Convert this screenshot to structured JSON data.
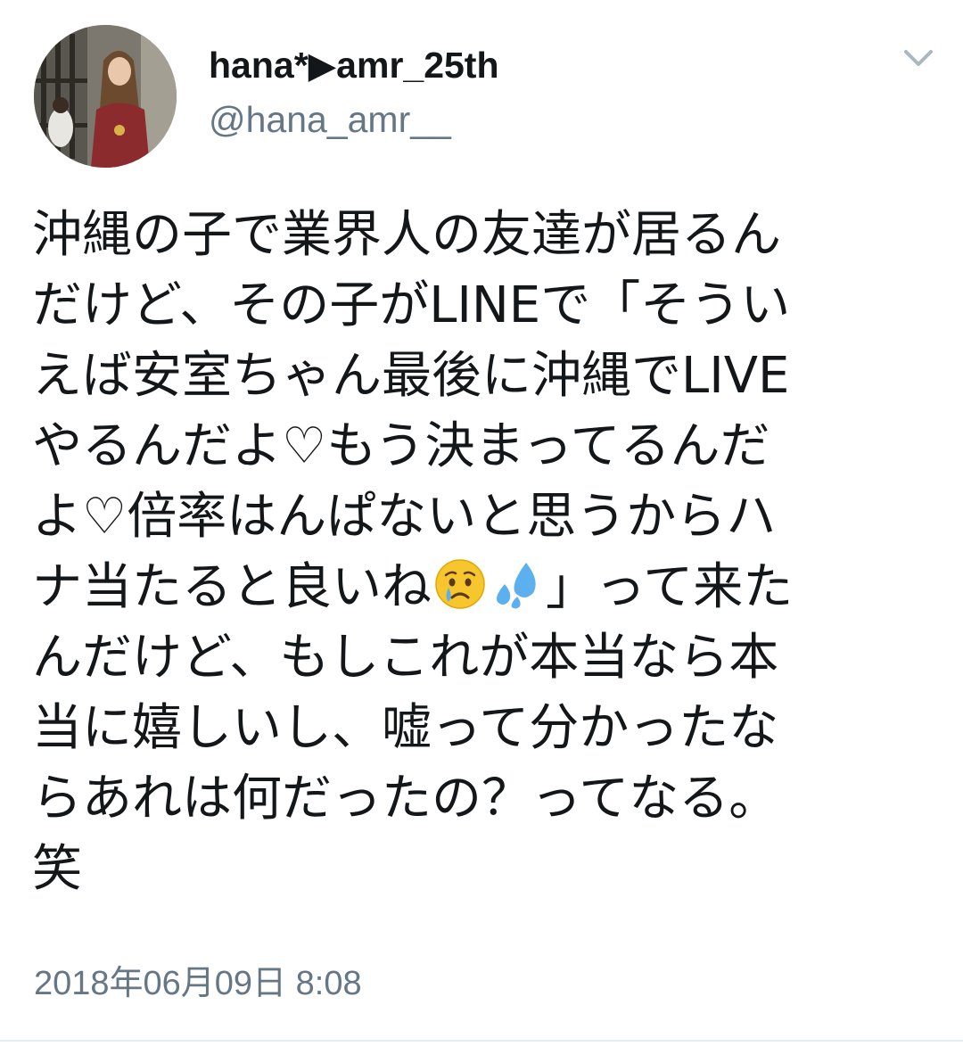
{
  "colors": {
    "text": "#14171a",
    "secondary": "#657786",
    "divider": "#e6ecf0"
  },
  "author": {
    "display_name": "hana*▶amr_25th",
    "handle": "@hana_amr__",
    "avatar_icon": "user-avatar-photo"
  },
  "menu": {
    "icon": "chevron-down-icon"
  },
  "tweet": {
    "lines": [
      "沖縄の子で業界人の友達が居るん",
      "だけど、その子がLINEで「そうい",
      "えば安室ちゃん最後に沖縄でLIVE",
      "やるんだよ♡もう決まってるんだ",
      "よ♡倍率はんぱないと思うからハ",
      "ナ当たると良いね",
      "」って来た",
      "んだけど、もしこれが本当なら本",
      "当に嬉しいし、嘘って分かったな",
      "らあれは何だったの？ってなる。",
      "笑"
    ],
    "emojis": [
      "crying-face-icon",
      "sweat-droplets-icon"
    ]
  },
  "timestamp": "2018年06月09日 8:08"
}
